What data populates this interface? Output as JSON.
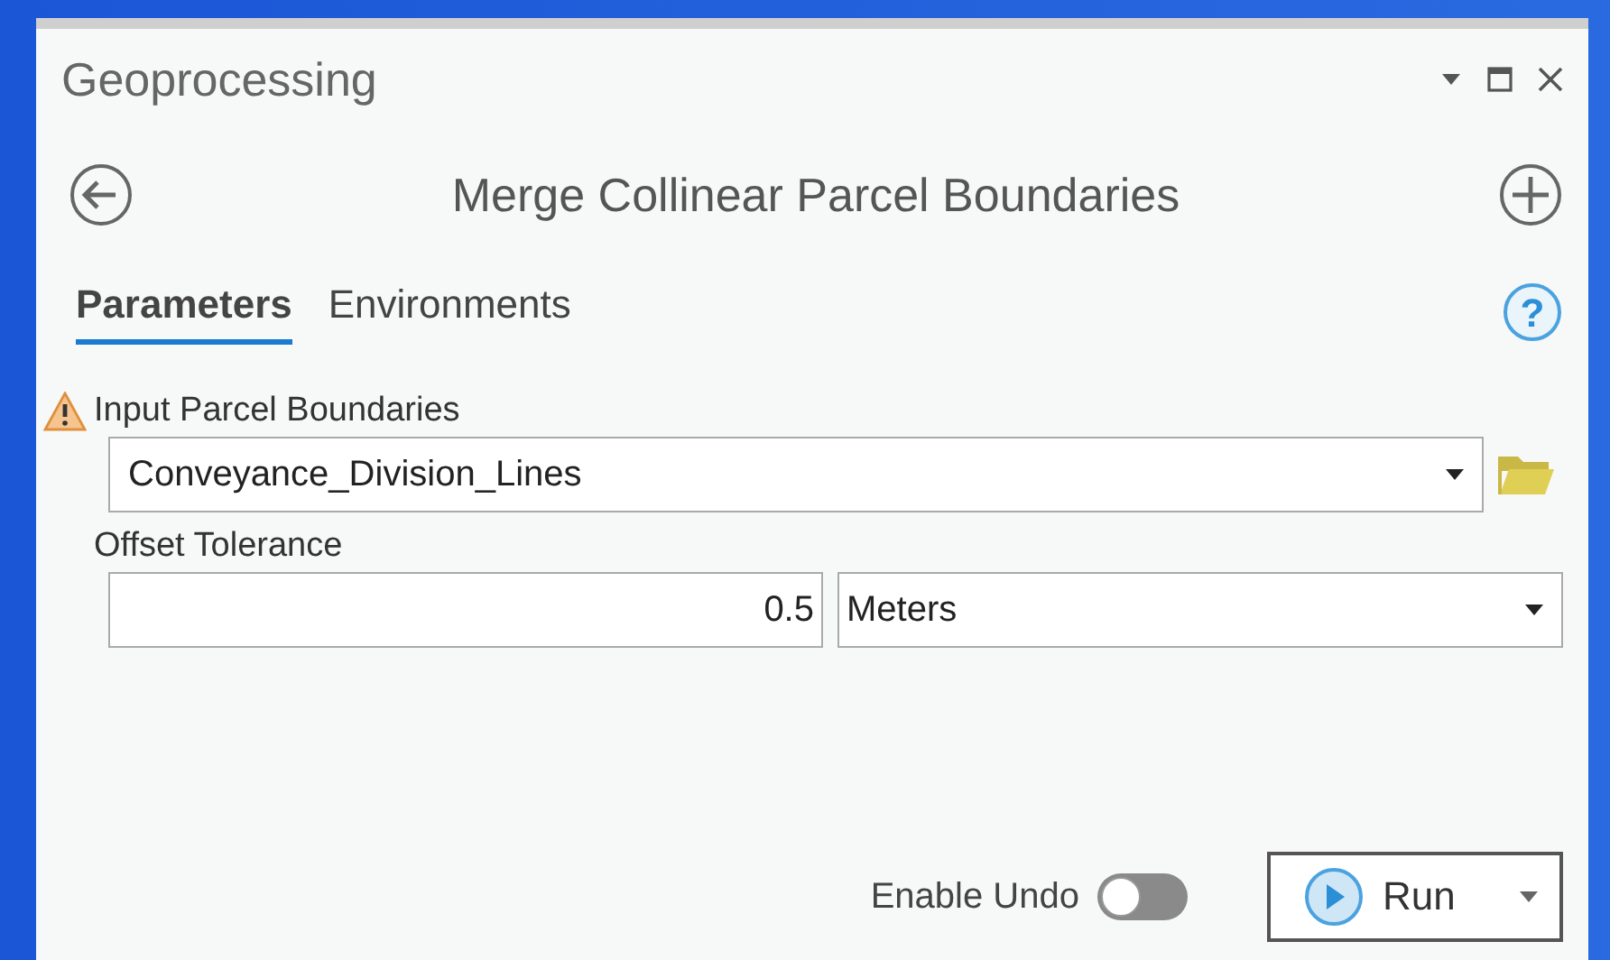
{
  "pane": {
    "title": "Geoprocessing"
  },
  "tool": {
    "title": "Merge Collinear Parcel Boundaries"
  },
  "tabs": [
    {
      "label": "Parameters",
      "selected": true
    },
    {
      "label": "Environments",
      "selected": false
    }
  ],
  "help": {
    "glyph": "?"
  },
  "parameters": [
    {
      "label": "Input Parcel Boundaries",
      "warning": true,
      "value": "Conveyance_Division_Lines"
    },
    {
      "label": "Offset Tolerance",
      "warning": false,
      "value": "0.5",
      "unit": "Meters"
    }
  ],
  "enable_undo": {
    "label": "Enable Undo",
    "on": false
  },
  "run_button": {
    "label": "Run"
  }
}
